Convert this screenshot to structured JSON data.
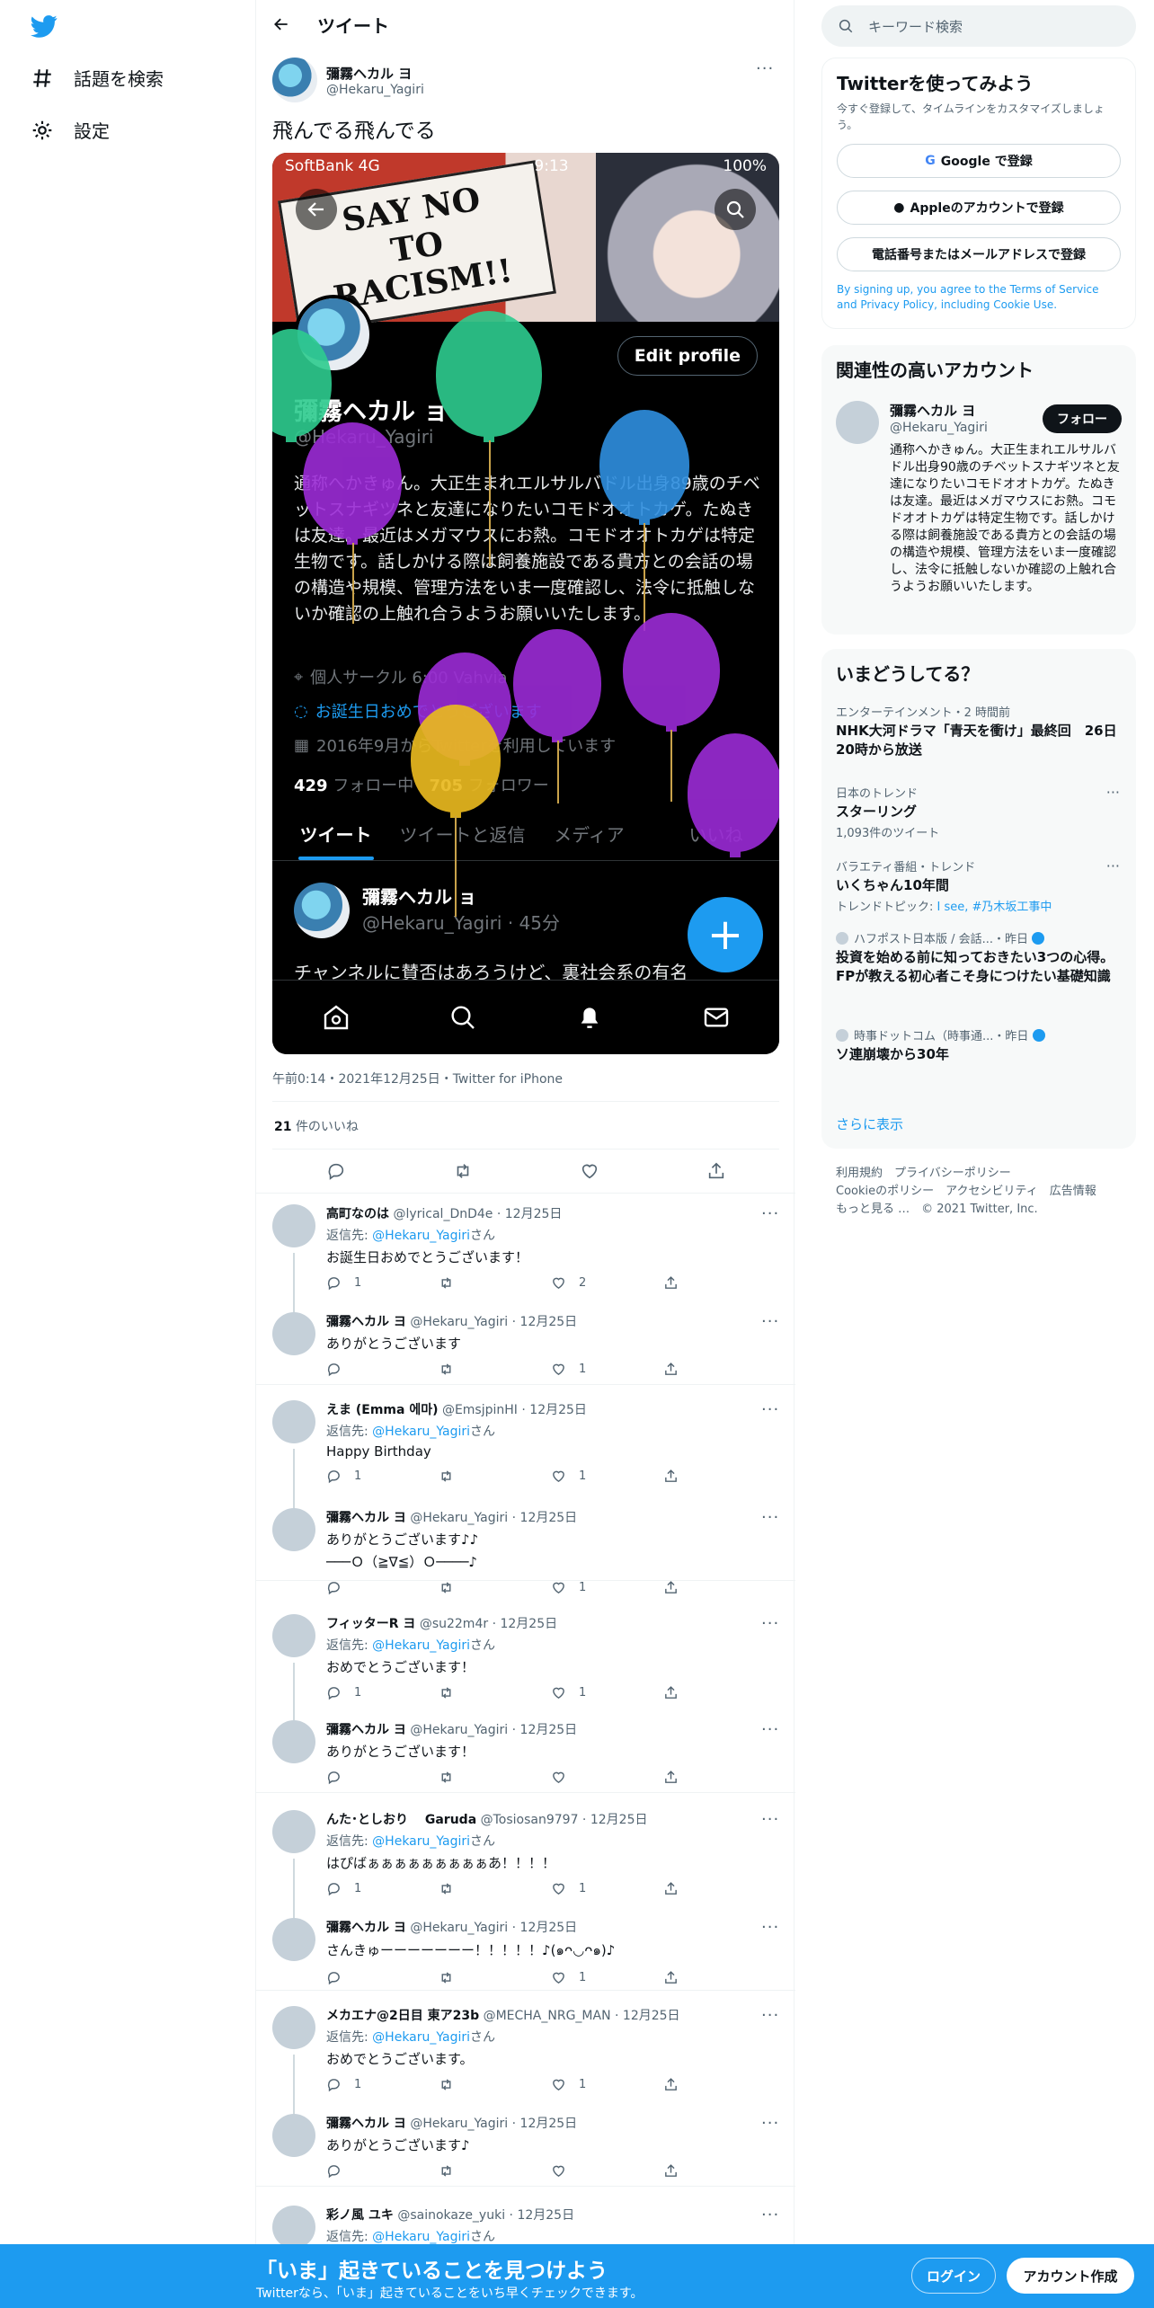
{
  "nav": {
    "explore": "話題を検索",
    "settings": "設定"
  },
  "header": {
    "title": "ツイート"
  },
  "tweet": {
    "name": "彌霧ヘカル ヨ",
    "handle": "@Hekaru_Yagiri",
    "text": "飛んでる飛んでる",
    "timestamp": "午前0:14・2021年12月25日・Twitter for iPhone",
    "likes_count": "21",
    "likes_label": "件のいいね"
  },
  "media": {
    "carrier": "SoftBank 4G",
    "time": "9:13",
    "battery": "100%",
    "sign_line1": "SAY NO",
    "sign_line2": "TO",
    "sign_line3": "RACISM!!",
    "edit_profile": "Edit profile",
    "name": "彌霧ヘカル ョ",
    "handle": "@Hekaru_Yagiri",
    "bio": "通称へかきゅん。大正生まれエルサルバドル出身89歳のチベットスナギツネと友達になりたいコモドオオトカゲ。たぬきは友達。最近はメガマウスにお熱。コモドオオトカゲは特定生物です。話しかける際は飼養施設である貴方との会話の場の構造や規模、管理方法をいま一度確認し、法令に抵触しないか確認の上触れ合うようお願いいたします。",
    "location": "個人サークル 6:00 Vahvia",
    "birthday": "お誕生日おめでとうございます",
    "joined": "2016年9月からTwitterを利用しています",
    "following_count": "429",
    "following_label": "フォロー中",
    "followers_count": "705",
    "followers_label": "フォロワー",
    "tabs": [
      "ツイート",
      "ツイートと返信",
      "メディア",
      "いいね"
    ],
    "inner_tweet_name": "彌霧ヘカル ョ",
    "inner_tweet_meta": "@Hekaru_Yagiri · 45分",
    "inner_tweet_text": "チャンネルに賛否はあろうけど、裏社会系の有名",
    "fab": "+"
  },
  "replies": [
    {
      "name": "高町なのは",
      "handle": "@lyrical_DnD4e",
      "date": "12月25日",
      "reply_to_label": "返信先:",
      "reply_to": "@Hekaru_Yagiri",
      "reply_to_suffix": "さん",
      "text": "お誕生日おめでとうございます！",
      "replies": "1",
      "retweets": "",
      "likes": "2",
      "thread": true
    },
    {
      "name": "彌霧ヘカル ヨ",
      "handle": "@Hekaru_Yagiri",
      "date": "12月25日",
      "reply_to_label": "",
      "reply_to": "",
      "reply_to_suffix": "",
      "text": "ありがとうございます",
      "replies": "",
      "retweets": "",
      "likes": "1",
      "thread": false
    },
    {
      "name": "えま (Emma 에마)",
      "handle": "@EmsjpinHI",
      "date": "12月25日",
      "reply_to_label": "返信先:",
      "reply_to": "@Hekaru_Yagiri",
      "reply_to_suffix": "さん",
      "text": "Happy Birthday",
      "replies": "1",
      "retweets": "",
      "likes": "1",
      "thread": true
    },
    {
      "name": "彌霧ヘカル ヨ",
      "handle": "@Hekaru_Yagiri",
      "date": "12月25日",
      "reply_to_label": "",
      "reply_to": "",
      "reply_to_suffix": "",
      "text": "ありがとうございます♪♪",
      "text2": "───Ｏ（≧∇≦）Ｏ────♪",
      "replies": "",
      "retweets": "",
      "likes": "1",
      "thread": false
    },
    {
      "name": "フィッターR ヨ",
      "handle": "@su22m4r",
      "date": "12月25日",
      "reply_to_label": "返信先:",
      "reply_to": "@Hekaru_Yagiri",
      "reply_to_suffix": "さん",
      "text": "おめでとうございます！",
      "replies": "1",
      "retweets": "",
      "likes": "1",
      "thread": true
    },
    {
      "name": "彌霧ヘカル ヨ",
      "handle": "@Hekaru_Yagiri",
      "date": "12月25日",
      "reply_to_label": "",
      "reply_to": "",
      "reply_to_suffix": "",
      "text": "ありがとうございます！",
      "replies": "",
      "retweets": "",
      "likes": "",
      "thread": false
    },
    {
      "name": "んた･としおり　 Garuda",
      "handle": "@Tosiosan9797",
      "date": "12月25日",
      "reply_to_label": "返信先:",
      "reply_to": "@Hekaru_Yagiri",
      "reply_to_suffix": "さん",
      "text": "はぴばぁぁぁぁぁぁぁぁぁあ！！！！",
      "replies": "1",
      "retweets": "",
      "likes": "1",
      "thread": true
    },
    {
      "name": "彌霧ヘカル ヨ",
      "handle": "@Hekaru_Yagiri",
      "date": "12月25日",
      "reply_to_label": "",
      "reply_to": "",
      "reply_to_suffix": "",
      "text": "さんきゅーーーーーーー！！！！！♪(๑ᴖ◡ᴖ๑)♪",
      "replies": "",
      "retweets": "",
      "likes": "1",
      "thread": false
    },
    {
      "name": "メカエナ@2日目 東ア23b",
      "handle": "@MECHA_NRG_MAN",
      "date": "12月25日",
      "reply_to_label": "返信先:",
      "reply_to": "@Hekaru_Yagiri",
      "reply_to_suffix": "さん",
      "text": "おめでとうございます。",
      "replies": "1",
      "retweets": "",
      "likes": "1",
      "thread": true
    },
    {
      "name": "彌霧ヘカル ヨ",
      "handle": "@Hekaru_Yagiri",
      "date": "12月25日",
      "reply_to_label": "",
      "reply_to": "",
      "reply_to_suffix": "",
      "text": "ありがとうございます♪",
      "replies": "",
      "retweets": "",
      "likes": "",
      "thread": false
    },
    {
      "name": "彩ノ風 ユキ",
      "handle": "@sainokaze_yuki",
      "date": "12月25日",
      "reply_to_label": "返信先:",
      "reply_to": "@Hekaru_Yagiri",
      "reply_to_suffix": "さん",
      "text": "",
      "replies": "",
      "retweets": "",
      "likes": "",
      "thread": true
    }
  ],
  "sidebar": {
    "search_placeholder": "キーワード検索",
    "signup_card": {
      "title": "Twitterを使ってみよう",
      "subtitle": "今すぐ登録して、タイムラインをカスタマイズしましょう。",
      "google": "Google で登録",
      "apple": "Appleのアカウントで登録",
      "phone": "電話番号またはメールアドレスで登録",
      "terms_prefix": "By signing up, you agree to the ",
      "terms": "Terms of Service",
      "and": " and ",
      "privacy": "Privacy Policy",
      "including": ", including ",
      "cookie": "Cookie Use",
      "period": "."
    },
    "relevant": {
      "title": "関連性の高いアカウント",
      "name": "彌霧ヘカル ヨ",
      "handle": "@Hekaru_Yagiri",
      "follow": "フォロー",
      "bio": "通称へかきゅん。大正生まれエルサルバドル出身90歳のチベットスナギツネと友達になりたいコモドオオトカゲ。たぬきは友達。最近はメガマウスにお熱。コモドオオトカゲは特定生物です。話しかける際は飼養施設である貴方との会話の場の構造や規模、管理方法をいま一度確認し、法令に抵触しないか確認の上触れ合うようお願いいたします。"
    },
    "trends": {
      "title": "いまどうしてる？",
      "items": [
        {
          "category": "エンターテインメント・2 時間前",
          "title": "NHK大河ドラマ「青天を衝け」最終回　26日20時から放送",
          "sub": "",
          "sub_link": ""
        },
        {
          "category": "日本のトレンド",
          "title": "スターリング",
          "sub": "1,093件のツイート",
          "sub_link": ""
        },
        {
          "category": "バラエティ番組・トレンド",
          "title": "いくちゃん10年間",
          "sub": "トレンドトピック: ",
          "sub_link": "I see, #乃木坂工事中"
        },
        {
          "category": "ハフポスト日本版 / 会話...・昨日",
          "title": "投資を始める前に知っておきたい3つの心得。FPが教える初心者こそ身につけたい基礎知識",
          "sub": "",
          "sub_link": ""
        },
        {
          "category": "時事ドットコム（時事通...・昨日",
          "title": "ソ連崩壊から30年",
          "sub": "",
          "sub_link": ""
        }
      ],
      "show_more": "さらに表示"
    },
    "footer": {
      "line1": "利用規約　プライバシーポリシー",
      "line2": "Cookieのポリシー　アクセシビリティ　広告情報",
      "line3": "もっと見る …　© 2021 Twitter, Inc."
    }
  },
  "bottom_bar": {
    "title": "「いま」起きていることを見つけよう",
    "subtitle": "Twitterなら、「いま」起きていることをいち早くチェックできます。",
    "login": "ログイン",
    "signup": "アカウント作成"
  },
  "colors": {
    "accent": "#1d9bf0",
    "text": "#0f1419",
    "muted": "#536471"
  }
}
